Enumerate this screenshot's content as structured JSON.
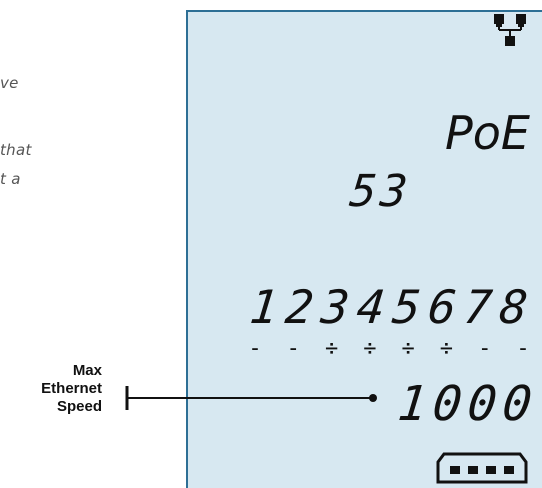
{
  "left_text_lines": [
    "ve",
    "that",
    "t a"
  ],
  "lcd": {
    "poe_label": "PoE",
    "value_number": "53",
    "pin_numbers": "12345678",
    "pin_marks": [
      "-",
      "-",
      "÷",
      "÷",
      "÷",
      "÷",
      "-",
      "-"
    ],
    "speed_value": "1000"
  },
  "annotation": {
    "line1": "Max",
    "line2": "Ethernet",
    "line3": "Speed"
  },
  "colors": {
    "lcd_background": "#d7e8f1",
    "lcd_border": "#2d6f95"
  }
}
